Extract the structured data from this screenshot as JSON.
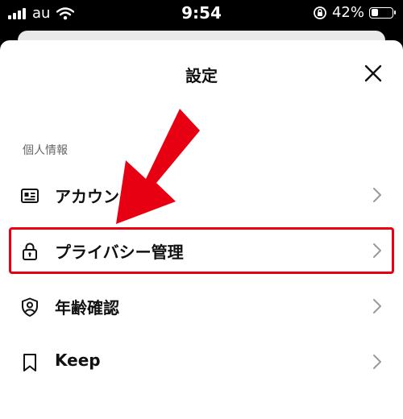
{
  "status_bar": {
    "carrier": "au",
    "time": "9:54",
    "battery_label": "42%",
    "battery_level": 0.42
  },
  "header": {
    "title": "設定"
  },
  "section": {
    "title": "個人情報"
  },
  "menu": {
    "items": [
      {
        "label": "アカウント",
        "icon": "id-card-icon"
      },
      {
        "label": "プライバシー管理",
        "icon": "lock-icon"
      },
      {
        "label": "年齢確認",
        "icon": "shield-person-icon"
      },
      {
        "label": "Keep",
        "icon": "bookmark-icon"
      }
    ]
  },
  "colors": {
    "highlight": "#e60012",
    "text": "#111111",
    "secondary_text": "#666666",
    "chevron": "#9a9a9a"
  }
}
